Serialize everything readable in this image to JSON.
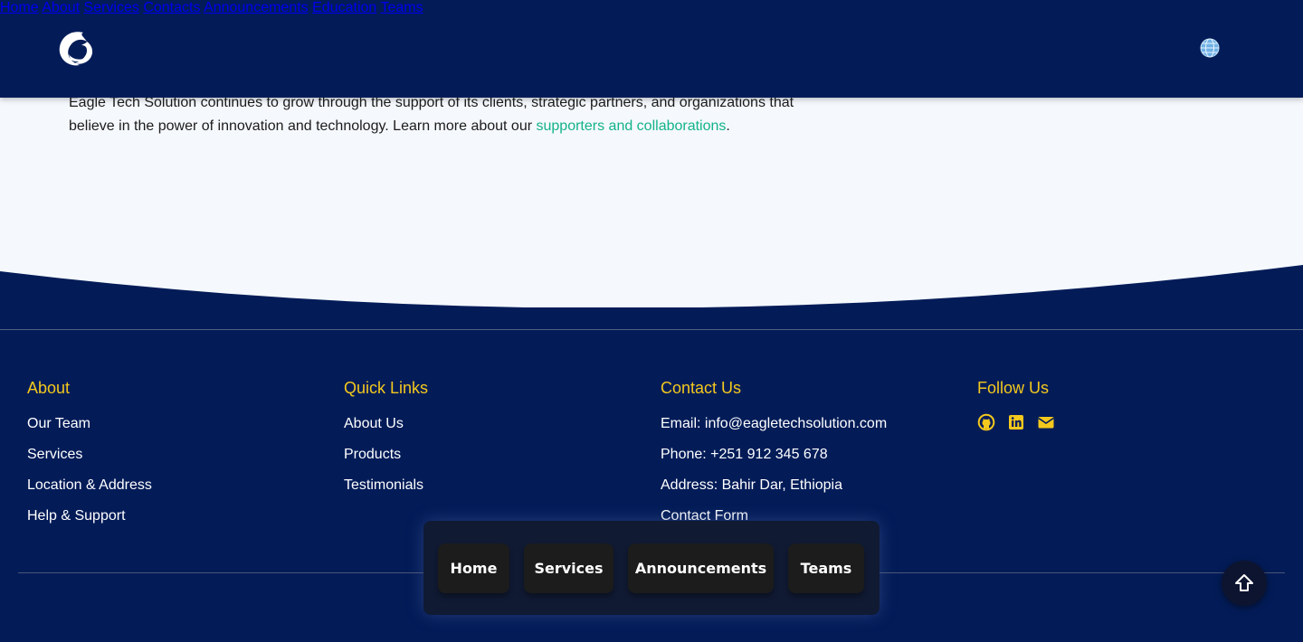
{
  "header": {
    "nav": [
      {
        "label": "Home"
      },
      {
        "label": "About"
      },
      {
        "label": "Services"
      },
      {
        "label": "Contacts"
      },
      {
        "label": "Announcements"
      },
      {
        "label": "Education"
      },
      {
        "label": "Teams"
      }
    ],
    "logo_icon": "eagle-swirl-logo",
    "language_icon": "globe-icon"
  },
  "content": {
    "paragraph_text": "Eagle Tech Solution continues to grow through the support of its clients, strategic partners, and organizations that believe in the power of innovation and technology. Learn more about our ",
    "link_text": "supporters and collaborations",
    "trailing": "."
  },
  "footer": {
    "about": {
      "title": "About",
      "items": [
        "Our Team",
        "Services",
        "Location & Address",
        "Help & Support"
      ]
    },
    "quick_links": {
      "title": "Quick Links",
      "items": [
        "About Us",
        "Products",
        "Testimonials"
      ]
    },
    "contact": {
      "title": "Contact Us",
      "items": [
        "Email: info@eagletechsolution.com",
        "Phone: +251 912 345 678",
        "Address: Bahir Dar, Ethiopia",
        "Contact Form"
      ]
    },
    "follow": {
      "title": "Follow Us",
      "icons": [
        "github-icon",
        "linkedin-icon",
        "email-icon"
      ]
    }
  },
  "floating_nav": {
    "items": [
      "Home",
      "Services",
      "Announcements",
      "Teams"
    ]
  },
  "colors": {
    "navy": "#031c58",
    "accent_yellow": "#f4c81d",
    "link_green": "#13b38a",
    "background": "#f5f8fd"
  }
}
